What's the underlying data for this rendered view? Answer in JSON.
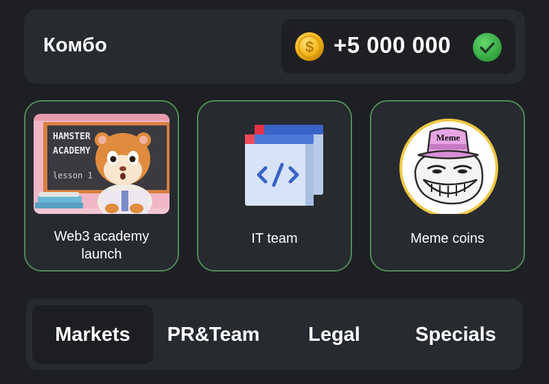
{
  "combo": {
    "title": "Комбо",
    "reward": "+5 000 000",
    "coin_icon": "coin-icon",
    "status_icon": "check-icon",
    "status_color": "#3db24b"
  },
  "cards": [
    {
      "label": "Web3 academy launch",
      "label_lines": [
        "Web3 academy",
        "launch"
      ],
      "art": {
        "board_line1": "HAMSTER",
        "board_line2": "ACADEMY",
        "board_line3": "lesson 1"
      }
    },
    {
      "label": "IT team",
      "icon": "code-window-icon"
    },
    {
      "label": "Meme coins",
      "art": {
        "hat_text": "Meme"
      }
    }
  ],
  "colors": {
    "card_border": "#4f8a57",
    "panel": "#272a2f",
    "background": "#1d1f23"
  },
  "tabs": [
    {
      "label": "Markets",
      "active": true
    },
    {
      "label": "PR&Team",
      "active": false
    },
    {
      "label": "Legal",
      "active": false
    },
    {
      "label": "Specials",
      "active": false
    }
  ]
}
